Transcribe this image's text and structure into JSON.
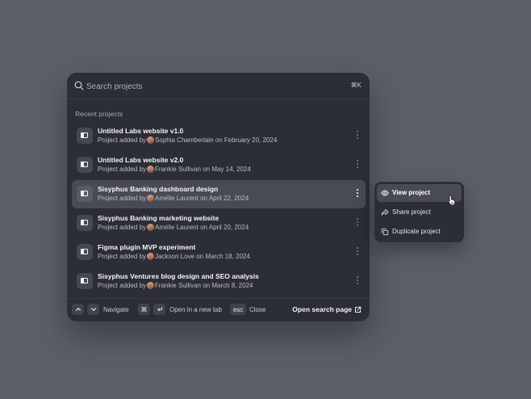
{
  "search": {
    "placeholder": "Search projects",
    "shortcut": "⌘K"
  },
  "section_label": "Recent projects",
  "projects": [
    {
      "title": "Untitled Labs website v1.0",
      "prefix": "Project added by",
      "author": "Sophia Chamberlain",
      "date": "on February 20, 2024"
    },
    {
      "title": "Untitled Labs website v2.0",
      "prefix": "Project added by",
      "author": "Frankie Sullivan",
      "date": "on May 14, 2024"
    },
    {
      "title": "Sisyphus Banking dashboard design",
      "prefix": "Project added by",
      "author": "Amélie Laurent",
      "date": "on April 22, 2024"
    },
    {
      "title": "Sisyphus Banking marketing website",
      "prefix": "Project added by",
      "author": "Amélie Laurent",
      "date": "on April 20, 2024"
    },
    {
      "title": "Figma plugin MVP experiment",
      "prefix": "Project added by",
      "author": "Jackson Love",
      "date": "on March 18, 2024"
    },
    {
      "title": "Sisyphus Ventures blog design and SEO analysis",
      "prefix": "Project added by",
      "author": "Frankie Sullivan",
      "date": "on March 8, 2024"
    }
  ],
  "active_index": 2,
  "footer": {
    "navigate": "Navigate",
    "open_tab": "Open in a new tab",
    "esc_key": "esc",
    "close": "Close",
    "open_search": "Open search page"
  },
  "context_menu": {
    "items": [
      {
        "label": "View project",
        "icon": "eye-icon"
      },
      {
        "label": "Share project",
        "icon": "share-icon"
      },
      {
        "label": "Duplicate project",
        "icon": "copy-icon"
      }
    ]
  },
  "colors": {
    "background": "#5b5f69",
    "panel": "#2b2e36",
    "highlight": "#484b55"
  }
}
